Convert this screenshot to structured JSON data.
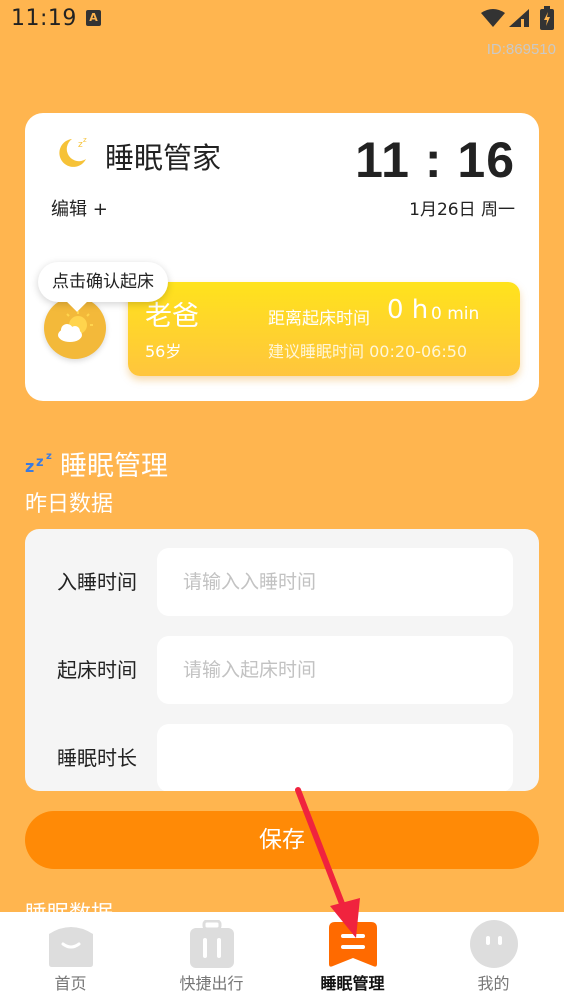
{
  "status_bar": {
    "time": "11:19",
    "device_id": "ID:869510"
  },
  "header": {
    "app_title": "睡眠管家",
    "clock": "11 : 16",
    "edit_label": "编辑 +",
    "date": "1月26日 周一"
  },
  "person": {
    "tooltip": "点击确认起床",
    "name": "老爸",
    "age": "56岁",
    "wake_label": "距离起床时间",
    "wake_hours": "0 h",
    "wake_mins": "0 min",
    "suggested_sleep": "建议睡眠时间 00:20-06:50"
  },
  "section": {
    "title": "睡眠管理",
    "subtitle": "昨日数据"
  },
  "form": {
    "rows": [
      {
        "label": "入睡时间",
        "placeholder": "请输入入睡时间",
        "value": ""
      },
      {
        "label": "起床时间",
        "placeholder": "请输入起床时间",
        "value": ""
      },
      {
        "label": "睡眠时长",
        "placeholder": "",
        "value": ""
      }
    ],
    "save_label": "保存"
  },
  "peek_title": "睡眠数据",
  "tabs": [
    {
      "label": "首页",
      "icon": "home-face-icon",
      "active": false
    },
    {
      "label": "快捷出行",
      "icon": "luggage-icon",
      "active": false
    },
    {
      "label": "睡眠管理",
      "icon": "sleep-menu-icon",
      "active": true
    },
    {
      "label": "我的",
      "icon": "profile-face-icon",
      "active": false
    }
  ],
  "colors": {
    "background": "#FFB54F",
    "accent": "#FF8A06",
    "active_tab": "#FF6A00",
    "annotation": "#F0233E"
  }
}
